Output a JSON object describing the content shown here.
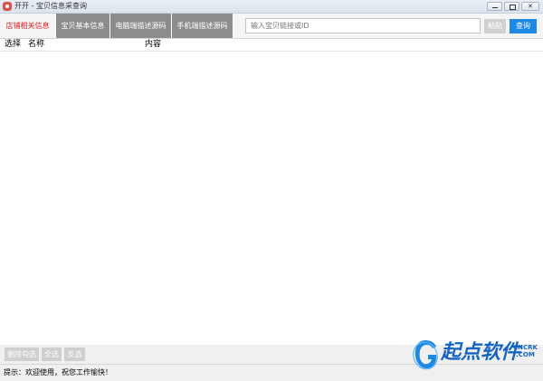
{
  "window": {
    "title": "开开 - 宝贝信息采查询"
  },
  "tabs": [
    {
      "label": "店铺相关信息"
    },
    {
      "label": "宝贝基本信息"
    },
    {
      "label": "电脑端描述源码"
    },
    {
      "label": "手机端描述源码"
    }
  ],
  "search": {
    "placeholder": "输入宝贝链接或ID"
  },
  "toolbar": {
    "paste_label": "粘贴",
    "query_label": "查询"
  },
  "list": {
    "columns": [
      "选择",
      "名称",
      "内容"
    ]
  },
  "bottom_buttons": {
    "delete_checked": "删除勾选",
    "select_all": "全选",
    "invert": "反选"
  },
  "status": {
    "text": "提示：欢迎使用，祝您工作愉快！"
  },
  "watermark": {
    "brand": "起点软件",
    "sub_top": "CNCRK",
    "sub_bottom": ".COM"
  },
  "colors": {
    "accent_blue": "#1e88e5",
    "tab_gray": "#8c8c8c",
    "active_tab_text": "#e02020"
  }
}
